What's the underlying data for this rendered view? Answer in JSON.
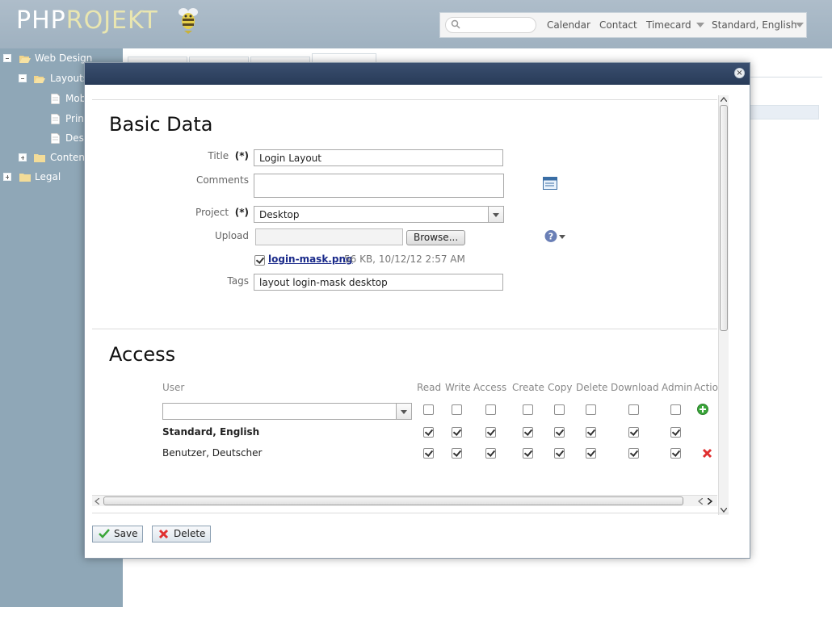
{
  "app": {
    "logo_php": "PHP",
    "logo_rojekt": "ROJEKT"
  },
  "topnav": {
    "search_placeholder": "",
    "links": [
      "Calendar",
      "Contact",
      "Timecard"
    ],
    "user_menu": "Standard, English"
  },
  "sidebar": {
    "items": [
      {
        "label": "Web Design"
      },
      {
        "label": "Layouts"
      },
      {
        "label": "Mob"
      },
      {
        "label": "Prin"
      },
      {
        "label": "Des"
      },
      {
        "label": "Content"
      },
      {
        "label": "Legal"
      }
    ]
  },
  "dialog": {
    "basic_title": "Basic Data",
    "fields": {
      "title_label": "Title",
      "required_marker": "(*)",
      "title_value": "Login Layout",
      "comments_label": "Comments",
      "comments_value": "",
      "project_label": "Project",
      "project_value": "Desktop",
      "upload_label": "Upload",
      "browse_label": "Browse...",
      "file_name": "login-mask.png",
      "file_meta": "56 KB, 10/12/12 2:57 AM",
      "tags_label": "Tags",
      "tags_value": "layout login-mask desktop"
    },
    "access_title": "Access",
    "access": {
      "user_header": "User",
      "columns": [
        "Read",
        "Write",
        "Access",
        "Create",
        "Copy",
        "Delete",
        "Download",
        "Admin",
        "Actio"
      ],
      "new_user_value": "",
      "rows": [
        {
          "user": "Standard, English",
          "bold": true,
          "checked": [
            true,
            true,
            true,
            true,
            true,
            true,
            true,
            true
          ]
        },
        {
          "user": "Benutzer, Deutscher",
          "bold": false,
          "checked": [
            true,
            true,
            true,
            true,
            true,
            true,
            true,
            true
          ]
        }
      ]
    },
    "buttons": {
      "save": "Save",
      "delete": "Delete"
    }
  },
  "colors": {
    "titlebar": "#283b58",
    "sidebar": "#8fa7b7",
    "link": "#1a2a8a",
    "delete_red": "#e03030",
    "add_green": "#3aa63a"
  }
}
